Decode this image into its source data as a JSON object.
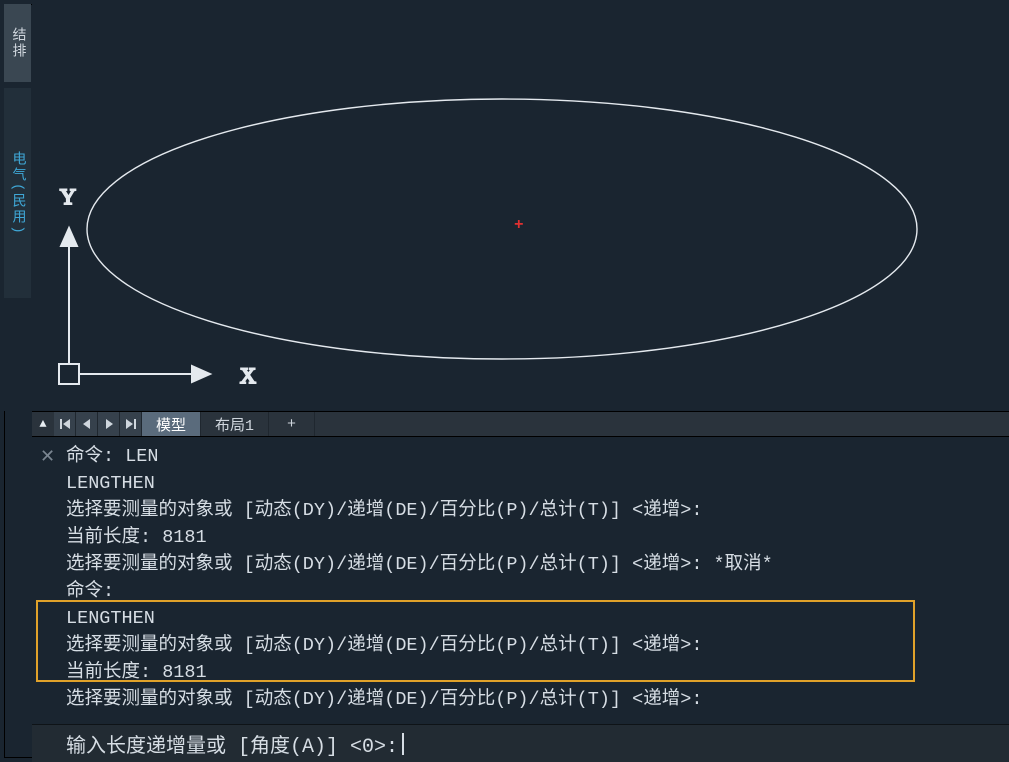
{
  "sidebar": {
    "top_label": "结排",
    "mid_label": "电气(民用)"
  },
  "axes": {
    "x": "X",
    "y": "Y"
  },
  "canvas": {
    "cross": "+"
  },
  "tabs": {
    "model": "模型",
    "layout1": "布局1",
    "add": "+"
  },
  "history": {
    "l1": "命令: LEN",
    "l2": "LENGTHEN",
    "l3": "选择要测量的对象或 [动态(DY)/递增(DE)/百分比(P)/总计(T)] <递增>:",
    "l4": "当前长度: 8181",
    "l5": "选择要测量的对象或 [动态(DY)/递增(DE)/百分比(P)/总计(T)] <递增>: *取消*",
    "l6": "命令:",
    "l7": "LENGTHEN",
    "l8": "选择要测量的对象或 [动态(DY)/递增(DE)/百分比(P)/总计(T)] <递增>:",
    "l9": "当前长度: 8181",
    "l10": "选择要测量的对象或 [动态(DY)/递增(DE)/百分比(P)/总计(T)] <递增>:"
  },
  "cmd": {
    "prompt": "输入长度递增量或 [角度(A)] <0>: "
  }
}
